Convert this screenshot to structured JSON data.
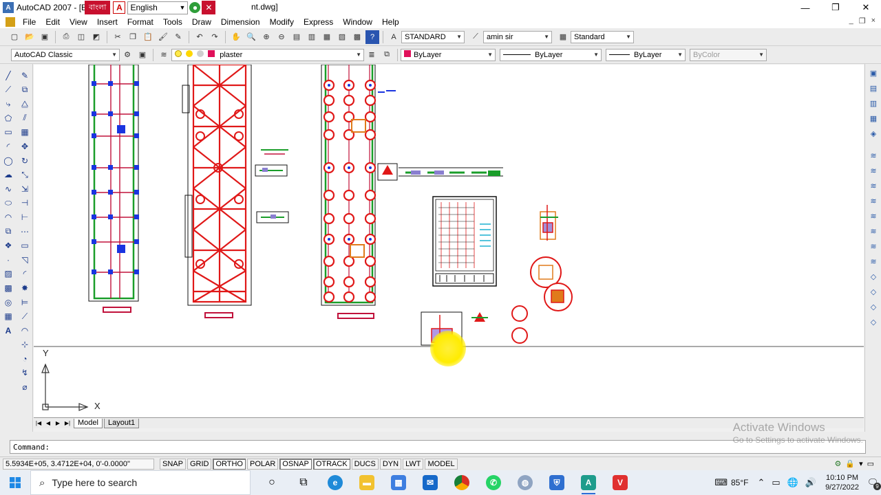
{
  "window": {
    "title": "AutoCAD 2007 - [E:\\",
    "title_suffix": "nt.dwg]",
    "ime_label": "বাংলা",
    "ime_language": "English",
    "controls": {
      "minimize": "—",
      "restore": "❐",
      "close": "✕"
    }
  },
  "menu": {
    "items": [
      "File",
      "Edit",
      "View",
      "Insert",
      "Format",
      "Tools",
      "Draw",
      "Dimension",
      "Modify",
      "Express",
      "Window",
      "Help"
    ],
    "doc_controls": [
      "_",
      "❐",
      "×"
    ]
  },
  "toolbar": {
    "text_style": "STANDARD",
    "dim_style": "amin sir",
    "table_style": "Standard",
    "workspace": "AutoCAD Classic",
    "layer": "plaster",
    "color": "ByLayer",
    "linetype": "ByLayer",
    "lineweight": "ByLayer",
    "plot_style": "ByColor"
  },
  "canvas": {
    "ucs_x": "X",
    "ucs_y": "Y"
  },
  "layout_tabs": {
    "model": "Model",
    "layout1": "Layout1"
  },
  "command": {
    "prompt": "Command:"
  },
  "watermark": {
    "line1": "Activate Windows",
    "line2": "Go to Settings to activate Windows."
  },
  "status": {
    "coordinates": "5.5934E+05, 3.4712E+04, 0'-0.0000\"",
    "toggles": [
      {
        "label": "SNAP",
        "on": false
      },
      {
        "label": "GRID",
        "on": false
      },
      {
        "label": "ORTHO",
        "on": true
      },
      {
        "label": "POLAR",
        "on": false
      },
      {
        "label": "OSNAP",
        "on": true
      },
      {
        "label": "OTRACK",
        "on": true
      },
      {
        "label": "DUCS",
        "on": false
      },
      {
        "label": "DYN",
        "on": false
      },
      {
        "label": "LWT",
        "on": false
      },
      {
        "label": "MODEL",
        "on": false
      }
    ]
  },
  "taskbar": {
    "search_placeholder": "Type here to search",
    "temperature": "85°F",
    "time": "10:10 PM",
    "date": "9/27/2022",
    "notification_count": "9"
  }
}
